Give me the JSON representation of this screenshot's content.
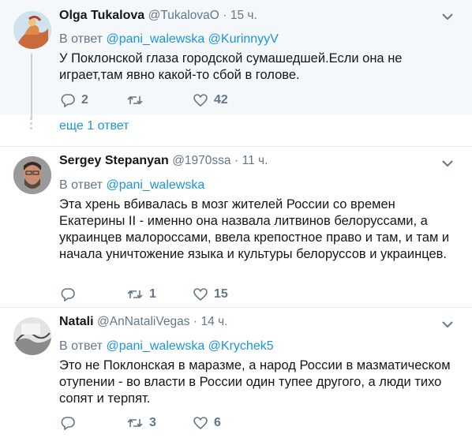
{
  "tweets": [
    {
      "name": "Olga Tukalova",
      "handle": "@TukalovaO",
      "dot": "·",
      "time": "15 ч.",
      "reply_prefix": "В ответ",
      "reply_to_1": "@pani_walewska",
      "reply_to_2": "@KurinnyyV",
      "text": "У Поклонской глаза городской сумашедшей.Если она не играет,там явно какой-то сбой в голове.",
      "replies": "2",
      "retweets": "",
      "likes": "42"
    },
    {
      "name": "Sergey Stepanyan",
      "handle": "@1970ssa",
      "dot": "·",
      "time": "11 ч.",
      "reply_prefix": "В ответ",
      "reply_to_1": "@pani_walewska",
      "text": "Эта хрень вбивалась в мозг жителей России со времен Екатерины II - именно она назвала литвинов белоруссами, а украинцев малороссами, ввела крепостное право и там, и там и начала уничтожение языка и культуры белоруссов и украинцев.",
      "replies": "",
      "retweets": "1",
      "likes": "15"
    },
    {
      "name": "Natali",
      "handle": "@AnNataliVegas",
      "dot": "·",
      "time": "14 ч.",
      "reply_prefix": "В ответ",
      "reply_to_1": "@pani_walewska",
      "reply_to_2": "@Krychek5",
      "text": "Это не Поклонская в маразме, а народ России в мазматическом отупении - во власти в России один тупее другого, а люди тихо сопят и терпят.",
      "replies": "",
      "retweets": "3",
      "likes": "6"
    }
  ],
  "more_replies": "еще 1 ответ",
  "colors": {
    "link": "#1b95e0",
    "muted": "#657786",
    "text": "#14171a",
    "thread_line": "#c4d2dc",
    "separator": "#e6ecf0",
    "highlight_bg": "#f5f8fa"
  },
  "icons": [
    "chevron-down-icon",
    "reply-icon",
    "retweet-icon",
    "like-icon"
  ]
}
